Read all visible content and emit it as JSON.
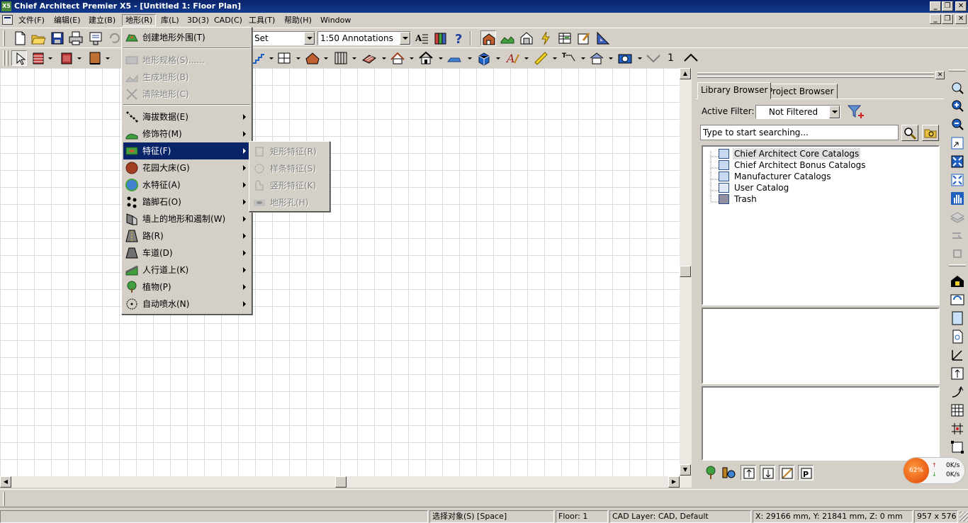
{
  "window": {
    "app_icon": "X5",
    "title": "Chief Architect Premier X5 - [Untitled 1: Floor Plan]",
    "controls": [
      "_",
      "❐",
      "✕"
    ],
    "mdi_controls": [
      "_",
      "❐",
      "✕"
    ]
  },
  "menubar": {
    "items": [
      "文件(F)",
      "编辑(E)",
      "建立(B)",
      "地形(R)",
      "库(L)",
      "3D(3)",
      "CAD(C)",
      "工具(T)",
      "帮助(H)",
      "Window"
    ],
    "active_index": 3
  },
  "toolbar": {
    "layer_set": "Set",
    "scale": "1:50 Annotations",
    "floor_number": "1"
  },
  "terrain_menu": {
    "items": [
      {
        "label": "创建地形外围(T)",
        "icon": "terrain-perimeter-icon",
        "submenu": false,
        "disabled": false
      },
      {
        "label": "地形规格(S)......",
        "icon": "terrain-specification-icon",
        "submenu": false,
        "disabled": true
      },
      {
        "label": "生成地形(B)",
        "icon": "build-terrain-icon",
        "submenu": false,
        "disabled": true
      },
      {
        "label": "清除地形(C)",
        "icon": "clear-terrain-icon",
        "submenu": false,
        "disabled": true
      },
      {
        "label": "海拔数据(E)",
        "icon": "elevation-data-icon",
        "submenu": true,
        "disabled": false
      },
      {
        "label": "修饰符(M)",
        "icon": "modifiers-icon",
        "submenu": true,
        "disabled": false
      },
      {
        "label": "特征(F)",
        "icon": "features-icon",
        "submenu": true,
        "disabled": false,
        "selected": true
      },
      {
        "label": "花园大床(G)",
        "icon": "garden-bed-icon",
        "submenu": true,
        "disabled": false
      },
      {
        "label": "水特征(A)",
        "icon": "water-feature-icon",
        "submenu": true,
        "disabled": false
      },
      {
        "label": "踏脚石(O)",
        "icon": "stepping-stones-icon",
        "submenu": true,
        "disabled": false
      },
      {
        "label": "墙上的地形和遏制(W)",
        "icon": "terrain-wall-icon",
        "submenu": true,
        "disabled": false
      },
      {
        "label": "路(R)",
        "icon": "road-icon",
        "submenu": true,
        "disabled": false
      },
      {
        "label": "车道(D)",
        "icon": "driveway-icon",
        "submenu": true,
        "disabled": false
      },
      {
        "label": "人行道上(K)",
        "icon": "sidewalk-icon",
        "submenu": true,
        "disabled": false
      },
      {
        "label": "植物(P)",
        "icon": "plant-icon",
        "submenu": true,
        "disabled": false
      },
      {
        "label": "自动喷水(N)",
        "icon": "sprinkler-icon",
        "submenu": true,
        "disabled": false
      }
    ]
  },
  "feature_submenu": {
    "items": [
      {
        "label": "矩形特征(R)",
        "icon": "rectangular-feature-icon"
      },
      {
        "label": "样条特征(S)",
        "icon": "spline-feature-icon"
      },
      {
        "label": "竖形特征(K)",
        "icon": "curved-feature-icon"
      },
      {
        "label": "地形孔(H)",
        "icon": "terrain-hole-icon"
      }
    ]
  },
  "library": {
    "tabs": [
      "Library Browser",
      "Project Browser"
    ],
    "active_filter_label": "Active Filter:",
    "active_filter_value": "Not Filtered",
    "search_placeholder": "Type to start searching...",
    "tree": [
      "Chief Architect Core Catalogs",
      "Chief Architect Bonus Catalogs",
      "Manufacturer Catalogs",
      "User Catalog",
      "Trash"
    ]
  },
  "network_widget": {
    "percent": "62%",
    "up": "0K/s",
    "down": "0K/s"
  },
  "statusbar": {
    "action": "选择对象(S) [Space]",
    "floor": "Floor: 1",
    "cad_layer": "CAD Layer: CAD,  Default",
    "coords": "X: 29166 mm, Y: 21841 mm, Z: 0 mm",
    "view_size": "957 x 576"
  }
}
